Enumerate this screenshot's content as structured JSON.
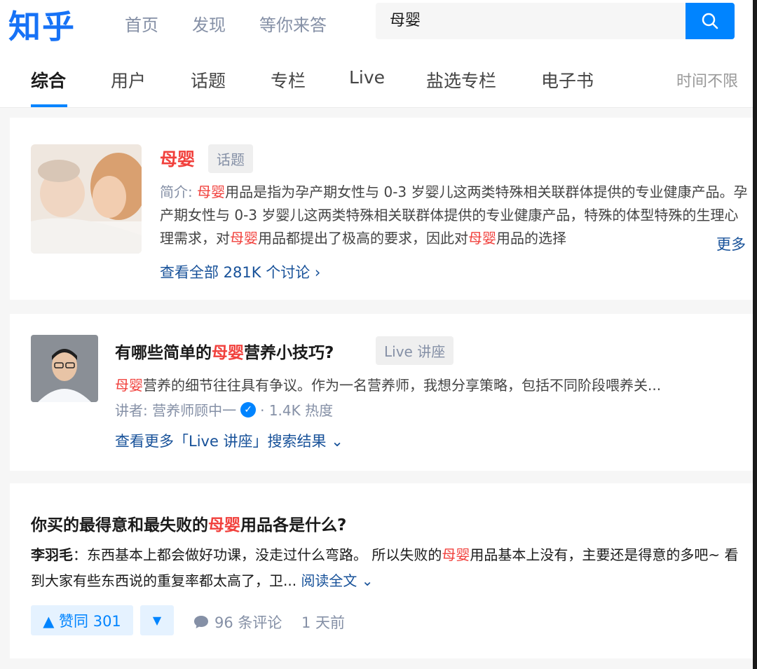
{
  "header": {
    "logo": "知乎",
    "nav": [
      "首页",
      "发现",
      "等你来答"
    ],
    "search_value": "母婴"
  },
  "tabs": {
    "items": [
      "综合",
      "用户",
      "话题",
      "专栏",
      "Live",
      "盐选专栏",
      "电子书"
    ],
    "active": "综合",
    "time_filter": "时间不限"
  },
  "topic_card": {
    "title": "母婴",
    "tag": "话题",
    "intro_label": "简介:",
    "intro_parts": [
      "母婴",
      "用品是指为孕产期女性与 0-3 岁婴儿这两类特殊相关联群体提供的专业健康产品。孕产期女性与 0-3 岁婴儿这两类特殊相关联群体提供的专业健康产品，特殊的体型特殊的生理心理需求，对",
      "母婴",
      "用品都提出了极高的要求，因此对",
      "母婴",
      "用品的选择"
    ],
    "more": "更多",
    "view_all": "查看全部 281K 个讨论 ›"
  },
  "live_card": {
    "title_parts": [
      "有哪些简单的",
      "母婴",
      "营养小技巧?"
    ],
    "tag": "Live 讲座",
    "desc_parts": [
      "母婴",
      "营养的细节往往具有争议。作为一名营养师，我想分享策略，包括不同阶段喂养关..."
    ],
    "speaker": "讲者: 营养师顾中一",
    "verified_mark": "✓",
    "heat": "· 1.4K 热度",
    "more_results": "查看更多「Live 讲座」搜索结果 ⌄"
  },
  "question_card": {
    "title_parts": [
      "你买的最得意和最失败的",
      "母婴",
      "用品各是什么?"
    ],
    "author": "李羽毛",
    "excerpt_parts": [
      "：东西基本上都会做好功课，没走过什么弯路。 所以失败的",
      "母婴",
      "用品基本上没有，主要还是得意的多吧~ 看到大家有些东西说的重复率都太高了，卫... "
    ],
    "read_full": "阅读全文 ⌄",
    "upvote_label": "▲ 赞同 301",
    "downvote_label": "▼",
    "comments": "96 条评论",
    "time_ago": "1 天前"
  },
  "colors": {
    "brand": "#1772f6",
    "accent": "#0084ff",
    "highlight": "#f1403c",
    "link": "#175199"
  }
}
